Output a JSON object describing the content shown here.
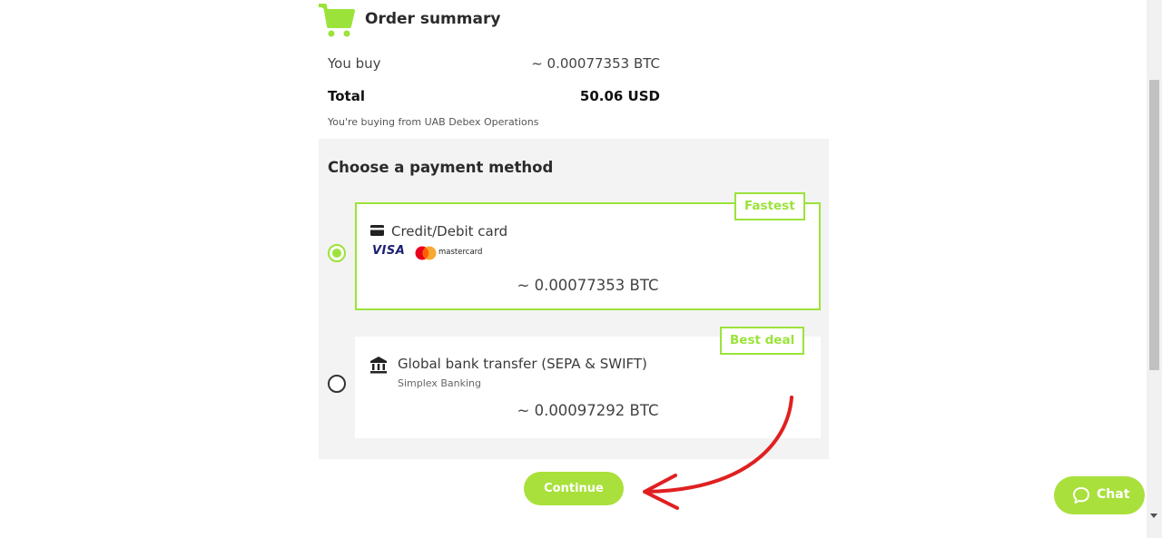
{
  "order_summary": {
    "title": "Order summary",
    "icon": "cart-icon",
    "you_buy_label": "You buy",
    "you_buy_value": "~ 0.00077353 BTC",
    "total_label": "Total",
    "total_value": "50.06 USD",
    "seller_note": "You're buying from UAB Debex Operations"
  },
  "payment": {
    "heading": "Choose a payment method",
    "options": [
      {
        "title": "Credit/Debit card",
        "icon": "credit-card-icon",
        "badge": "Fastest",
        "brands": [
          "VISA",
          "mastercard"
        ],
        "amount": "~ 0.00077353 BTC",
        "selected": true
      },
      {
        "title": "Global bank transfer (SEPA & SWIFT)",
        "subtitle": "Simplex Banking",
        "icon": "bank-icon",
        "badge": "Best deal",
        "amount": "~ 0.00097292 BTC",
        "selected": false
      }
    ]
  },
  "actions": {
    "continue_label": "Continue"
  },
  "chat": {
    "label": "Chat",
    "icon": "chat-bubble-icon"
  },
  "colors": {
    "accent": "#9be33a",
    "button": "#a9e03c",
    "panel_bg": "#f3f3f3",
    "arrow": "#e02020"
  }
}
